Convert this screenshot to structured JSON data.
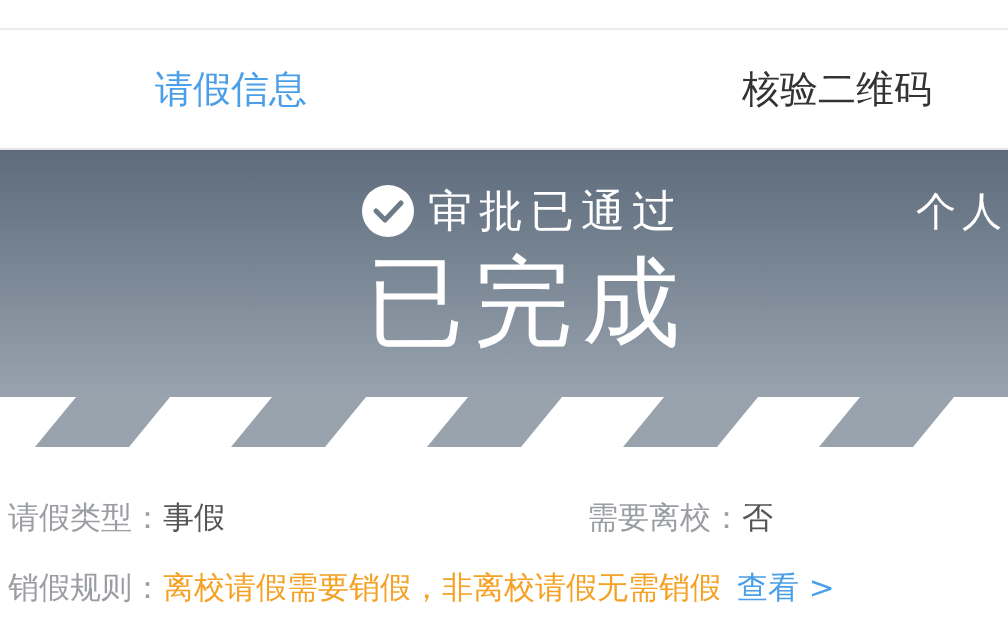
{
  "tabs": [
    {
      "label": "请假信息",
      "selected": true
    },
    {
      "label": "核验二维码",
      "selected": false
    }
  ],
  "banner": {
    "approval": "审批已通过",
    "status": "已完成",
    "side_text": "个人"
  },
  "rows": [
    {
      "items": [
        {
          "kind": "plain",
          "label": "请假类型：",
          "value": "事假"
        },
        {
          "kind": "plain",
          "label": "需要离校：",
          "value": "否"
        }
      ]
    },
    {
      "items": [
        {
          "kind": "notice",
          "label": "销假规则：",
          "value": "离校请假需要销假，非离校请假无需销假",
          "link": "查看 >"
        }
      ]
    }
  ]
}
